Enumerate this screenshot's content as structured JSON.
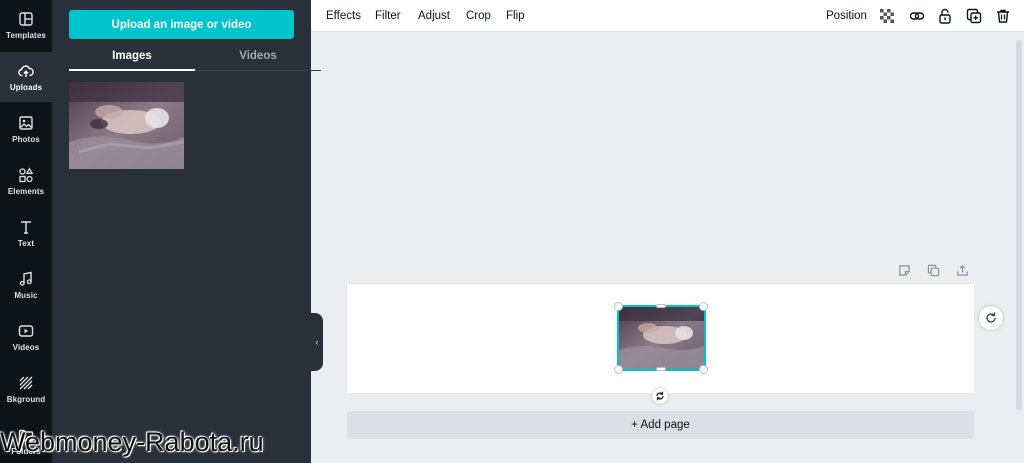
{
  "rail": {
    "items": [
      {
        "label": "Templates",
        "icon": "templates-icon"
      },
      {
        "label": "Uploads",
        "icon": "upload-cloud-icon",
        "active": true
      },
      {
        "label": "Photos",
        "icon": "photo-icon"
      },
      {
        "label": "Elements",
        "icon": "shapes-icon"
      },
      {
        "label": "Text",
        "icon": "text-icon"
      },
      {
        "label": "Music",
        "icon": "music-note-icon"
      },
      {
        "label": "Videos",
        "icon": "video-play-icon"
      },
      {
        "label": "Bkground",
        "icon": "hatch-pattern-icon"
      },
      {
        "label": "Folders",
        "icon": "folder-icon"
      }
    ]
  },
  "panel": {
    "upload_button": "Upload an image or video",
    "tabs": [
      {
        "label": "Images",
        "active": true
      },
      {
        "label": "Videos",
        "active": false
      }
    ]
  },
  "toolbar": {
    "left": [
      "Effects",
      "Filter",
      "Adjust",
      "Crop",
      "Flip"
    ],
    "position": "Position",
    "icons": [
      "transparency-checker-icon",
      "link-icon",
      "lock-icon",
      "duplicate-icon",
      "trash-icon"
    ]
  },
  "canvas": {
    "page_actions": [
      "notes-icon",
      "copy-page-icon",
      "export-page-icon"
    ],
    "add_page": "+ Add page",
    "rotate_icon": "rotate-icon",
    "refresh_icon": "refresh-icon"
  },
  "watermark": "Webmoney-Rabota.ru",
  "colors": {
    "accent": "#00c4cc",
    "rail_bg": "#0e1318",
    "panel_bg": "#293039",
    "canvas_bg": "#ebedf0"
  }
}
